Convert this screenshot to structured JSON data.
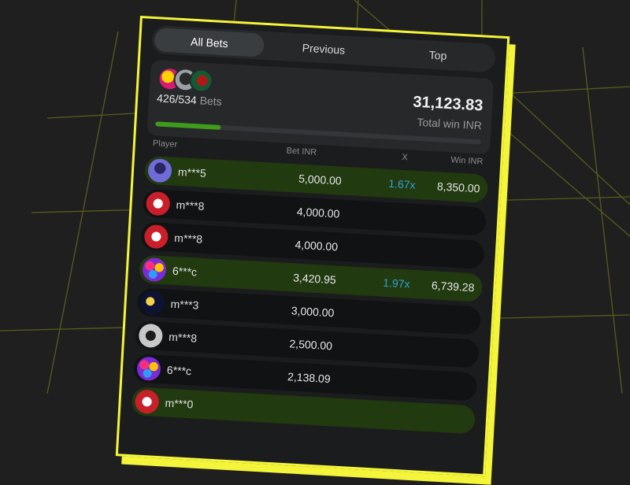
{
  "tabs": [
    {
      "label": "All Bets",
      "active": true
    },
    {
      "label": "Previous",
      "active": false
    },
    {
      "label": "Top",
      "active": false
    }
  ],
  "summary": {
    "bets_count": "426/534",
    "bets_label": "Bets",
    "total_amount": "31,123.83",
    "total_label": "Total win INR",
    "progress_fraction": 0.2
  },
  "headers": {
    "player": "Player",
    "bet": "Bet INR",
    "x": "X",
    "win": "Win INR"
  },
  "rows": [
    {
      "name": "m***5",
      "bet": "5,000.00",
      "mult": "1.67x",
      "win": "8,350.00",
      "won": true,
      "avatar": "purple-avatar"
    },
    {
      "name": "m***8",
      "bet": "4,000.00",
      "mult": "",
      "win": "",
      "won": false,
      "avatar": "red-avatar"
    },
    {
      "name": "m***8",
      "bet": "4,000.00",
      "mult": "",
      "win": "",
      "won": false,
      "avatar": "red-avatar"
    },
    {
      "name": "6***c",
      "bet": "3,420.95",
      "mult": "1.97x",
      "win": "6,739.28",
      "won": true,
      "avatar": "candy-avatar"
    },
    {
      "name": "m***3",
      "bet": "3,000.00",
      "mult": "",
      "win": "",
      "won": false,
      "avatar": "moon-avatar"
    },
    {
      "name": "m***8",
      "bet": "2,500.00",
      "mult": "",
      "win": "",
      "won": false,
      "avatar": "dog-avatar"
    },
    {
      "name": "6***c",
      "bet": "2,138.09",
      "mult": "",
      "win": "",
      "won": false,
      "avatar": "candy-avatar"
    },
    {
      "name": "m***0",
      "bet": "",
      "mult": "",
      "win": "",
      "won": true,
      "avatar": "red-avatar"
    }
  ],
  "colors": {
    "accent_yellow": "#f4f43a",
    "win_row": "#223a0f",
    "multiplier": "#2ea3d6",
    "progress": "#3f9c1b"
  }
}
